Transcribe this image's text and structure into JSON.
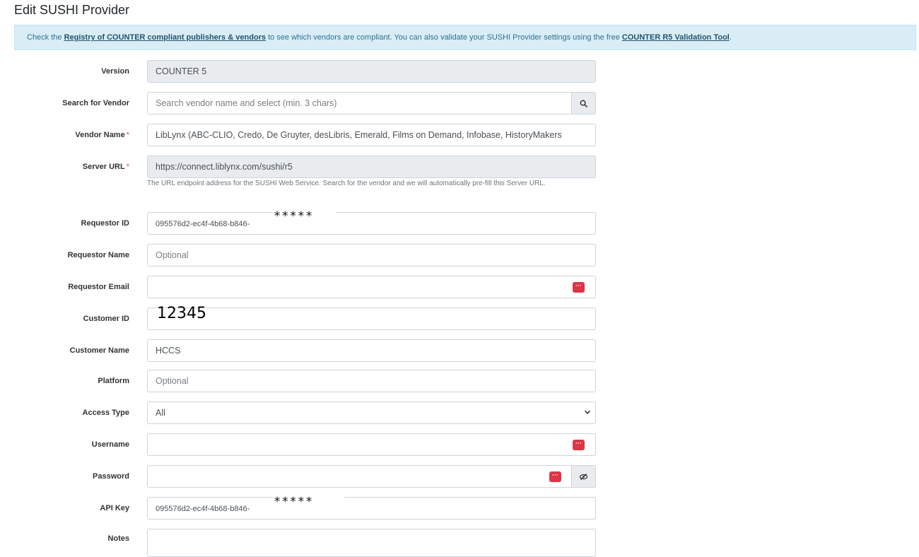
{
  "page": {
    "title": "Edit SUSHI Provider"
  },
  "info": {
    "text_1": "Check the ",
    "link_1": "Registry of COUNTER compliant publishers & vendors",
    "text_2": " to see which vendors are compliant. You can also validate your SUSHI Provider settings using the free ",
    "link_2": "COUNTER R5 Validation Tool",
    "text_3": "."
  },
  "form": {
    "version": {
      "label": "Version",
      "value": "COUNTER 5"
    },
    "search_vendor": {
      "label": "Search for Vendor",
      "placeholder": "Search vendor name and select (min. 3 chars)",
      "icon": "search-icon"
    },
    "vendor_name": {
      "label": "Vendor Name",
      "required_mark": "*",
      "value": "LibLynx (ABC-CLIO, Credo, De Gruyter, desLibris, Emerald, Films on Demand, Infobase, HistoryMakers"
    },
    "server_url": {
      "label": "Server URL",
      "required_mark": "*",
      "value": "https://connect.liblynx.com/sushi/r5",
      "help": "The URL endpoint address for the SUSHI Web Service. Search for the vendor and we will automatically pre-fill this Server URL."
    },
    "requestor_id": {
      "label": "Requestor ID",
      "value": "095576d2-ec4f-4b68-b846-",
      "mask": "*****"
    },
    "requestor_name": {
      "label": "Requestor Name",
      "placeholder": "Optional"
    },
    "requestor_email": {
      "label": "Requestor Email",
      "value": "",
      "badge": "···"
    },
    "customer_id": {
      "label": "Customer ID",
      "value": "12345"
    },
    "customer_name": {
      "label": "Customer Name",
      "value": "HCCS"
    },
    "platform": {
      "label": "Platform",
      "placeholder": "Optional"
    },
    "access_type": {
      "label": "Access Type",
      "value": "All"
    },
    "username": {
      "label": "Username",
      "value": "",
      "badge": "···"
    },
    "password": {
      "label": "Password",
      "value": "",
      "badge": "···",
      "icon": "eye-slash-icon"
    },
    "api_key": {
      "label": "API Key",
      "value": "095576d2-ec4f-4b68-b846-",
      "mask": "*****"
    },
    "notes": {
      "label": "Notes",
      "value": ""
    }
  },
  "colors": {
    "info_bg": "#d9edf7",
    "required": "#d9534f",
    "badge": "#dc3545"
  }
}
